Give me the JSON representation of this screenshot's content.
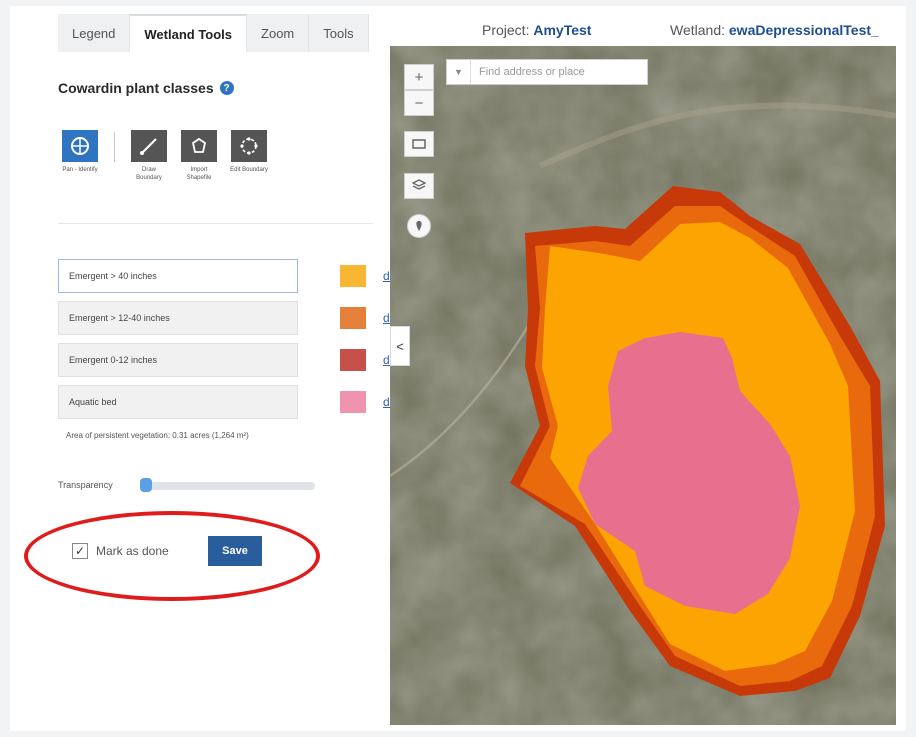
{
  "tabs": [
    {
      "label": "Legend",
      "active": false
    },
    {
      "label": "Wetland Tools",
      "active": true
    },
    {
      "label": "Zoom",
      "active": false
    },
    {
      "label": "Tools",
      "active": false
    }
  ],
  "header": {
    "project_label": "Project:",
    "project_value": "AmyTest",
    "wetland_label": "Wetland:",
    "wetland_value": "ewaDepressionalTest_"
  },
  "panel": {
    "title": "Cowardin plant classes",
    "help_icon": "?",
    "tools": [
      {
        "icon": "pan-identify-icon",
        "label": "Pan - Identify",
        "active": true
      },
      {
        "icon": "draw-boundary-icon",
        "label": "Draw Boundary",
        "active": false
      },
      {
        "icon": "import-shapefile-icon",
        "label": "Import Shapefile",
        "active": false
      },
      {
        "icon": "edit-boundary-icon",
        "label": "Edit Boundary",
        "active": false
      }
    ],
    "classes": [
      {
        "label": "Emergent > 40 inches",
        "color": "#f9b632",
        "delete": "delete"
      },
      {
        "label": "Emergent > 12-40 inches",
        "color": "#e5803a",
        "delete": "delete"
      },
      {
        "label": "Emergent 0-12 inches",
        "color": "#c8504a",
        "delete": "delete"
      },
      {
        "label": "Aquatic bed",
        "color": "#ef93ae",
        "delete": "delete"
      }
    ],
    "area_text": "Area of persistent vegetation: 0.31 acres (1,264 m²)",
    "transparency_label": "Transparency",
    "transparency_value": 0,
    "mark_done_label": "Mark as done",
    "mark_done_checked": true,
    "save_label": "Save"
  },
  "map": {
    "search_placeholder": "Find address or place",
    "zoom_in": "+",
    "zoom_out": "−",
    "collapse": "<",
    "colors": {
      "outer": "#c8390a",
      "mid": "#e86a0c",
      "main": "#fba402",
      "aquatic": "#e8708f"
    }
  },
  "annotation_color": "#e01b1b"
}
